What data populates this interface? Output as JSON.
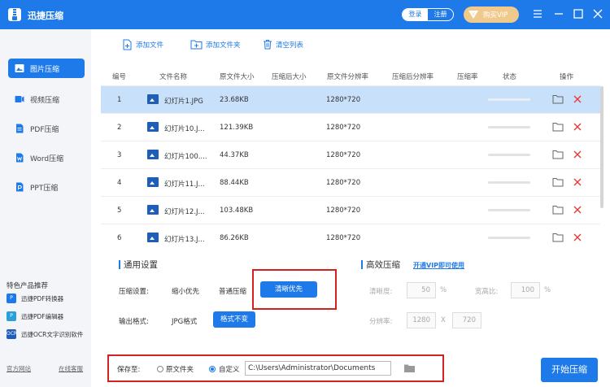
{
  "app": {
    "title": "迅捷压缩"
  },
  "header": {
    "login": "登录",
    "register": "注册",
    "vip": "购买VIP"
  },
  "colors": {
    "accent": "#1e7ae8",
    "highlight_row": "#c9e0fb",
    "delete": "#e53935",
    "annotation": "#d32020",
    "vip": "#f0c98c"
  },
  "sidebar": {
    "items": [
      {
        "label": "图片压缩",
        "icon": "image-icon",
        "active": true
      },
      {
        "label": "视频压缩",
        "icon": "video-icon",
        "active": false
      },
      {
        "label": "PDF压缩",
        "icon": "pdf-icon",
        "active": false
      },
      {
        "label": "Word压缩",
        "icon": "word-icon",
        "active": false
      },
      {
        "label": "PPT压缩",
        "icon": "ppt-icon",
        "active": false
      }
    ],
    "promo_title": "特色产品推荐",
    "promos": [
      {
        "label": "迅捷PDF转换器",
        "icon": "pdf-converter-icon"
      },
      {
        "label": "迅捷PDF编辑器",
        "icon": "pdf-editor-icon"
      },
      {
        "label": "迅捷OCR文字识别软件",
        "icon": "ocr-icon"
      }
    ],
    "footer": {
      "website": "官方网站",
      "support": "在线客服"
    }
  },
  "toolbar": {
    "add_file": "添加文件",
    "add_folder": "添加文件夹",
    "clear_list": "清空列表"
  },
  "table": {
    "headers": [
      "编号",
      "文件名称",
      "原文件大小",
      "压缩后大小",
      "原文件分辨率",
      "压缩后分辨率",
      "压缩率",
      "状态",
      "操作"
    ],
    "rows": [
      {
        "index": "1",
        "name": "幻灯片1.JPG",
        "size": "23.68KB",
        "resolution": "1280*720",
        "selected": true
      },
      {
        "index": "2",
        "name": "幻灯片10.J...",
        "size": "121.39KB",
        "resolution": "1280*720",
        "selected": false
      },
      {
        "index": "3",
        "name": "幻灯片100....",
        "size": "44.37KB",
        "resolution": "1280*720",
        "selected": false
      },
      {
        "index": "4",
        "name": "幻灯片11.J...",
        "size": "88.44KB",
        "resolution": "1280*720",
        "selected": false
      },
      {
        "index": "5",
        "name": "幻灯片12.J...",
        "size": "103.48KB",
        "resolution": "1280*720",
        "selected": false
      },
      {
        "index": "6",
        "name": "幻灯片13.J...",
        "size": "86.26KB",
        "resolution": "1280*720",
        "selected": false
      }
    ]
  },
  "settings": {
    "general_title": "通用设置",
    "compress_label": "压缩设置:",
    "compress_options": [
      "缩小优先",
      "普通压缩",
      "清晰优先"
    ],
    "output_label": "输出格式:",
    "output_options": [
      "JPG格式",
      "格式不变"
    ],
    "efficient_title": "高效压缩",
    "vip_link": "开通VIP即可使用",
    "clarity_label": "清晰度:",
    "clarity_value": "50",
    "clarity_unit": "%",
    "aspect_label": "宽高比:",
    "aspect_value": "100",
    "aspect_unit": "%",
    "resolution_label": "分辨率:",
    "res_width": "1280",
    "res_sep": "X",
    "res_height": "720"
  },
  "savebar": {
    "label": "保存至:",
    "option_original": "原文件夹",
    "option_custom": "自定义",
    "path": "C:\\Users\\Administrator\\Documents",
    "start": "开始压缩"
  }
}
